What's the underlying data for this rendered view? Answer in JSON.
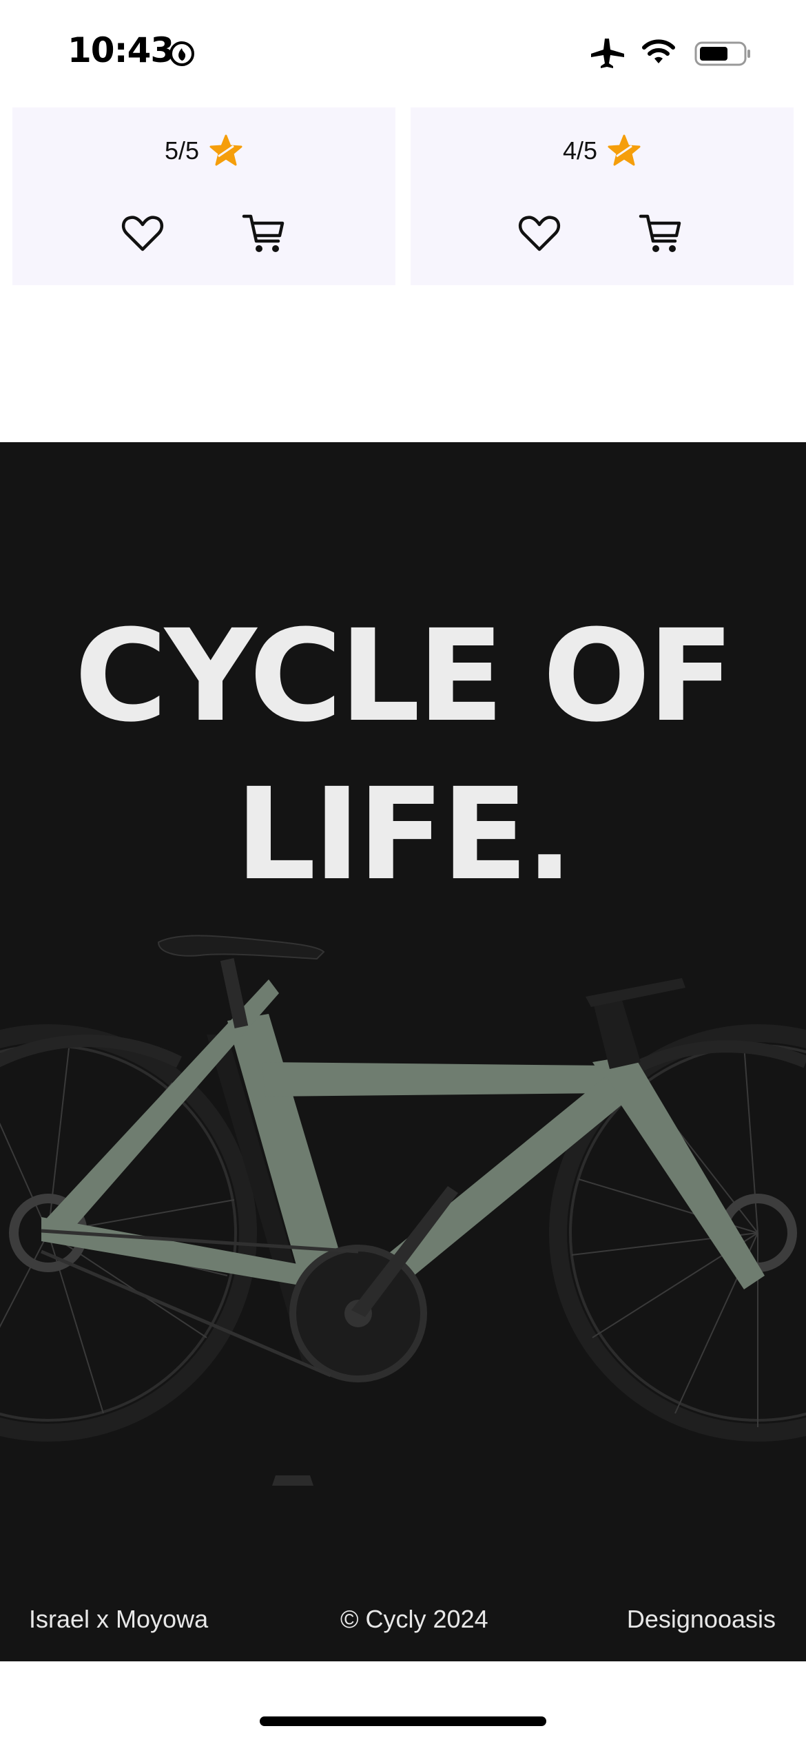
{
  "status_bar": {
    "time": "10:43",
    "icons": [
      "flame-icon",
      "airplane-icon",
      "wifi-icon",
      "battery-icon"
    ]
  },
  "products": [
    {
      "rating": "5/5",
      "icons": [
        "star-icon",
        "heart-icon",
        "cart-icon"
      ]
    },
    {
      "rating": "4/5",
      "icons": [
        "star-icon",
        "heart-icon",
        "cart-icon"
      ]
    }
  ],
  "hero": {
    "title_line1": "CYCLE OF",
    "title_line2": "LIFE."
  },
  "footer": {
    "left": "Israel x Moyowa",
    "center": "© Cycly 2024",
    "right": "Designooasis"
  },
  "colors": {
    "card_background": "#f7f5fd",
    "star": "#f59e0b",
    "hero_background": "#141414",
    "hero_text": "#ececec",
    "bike_frame": "#6f7d70"
  }
}
